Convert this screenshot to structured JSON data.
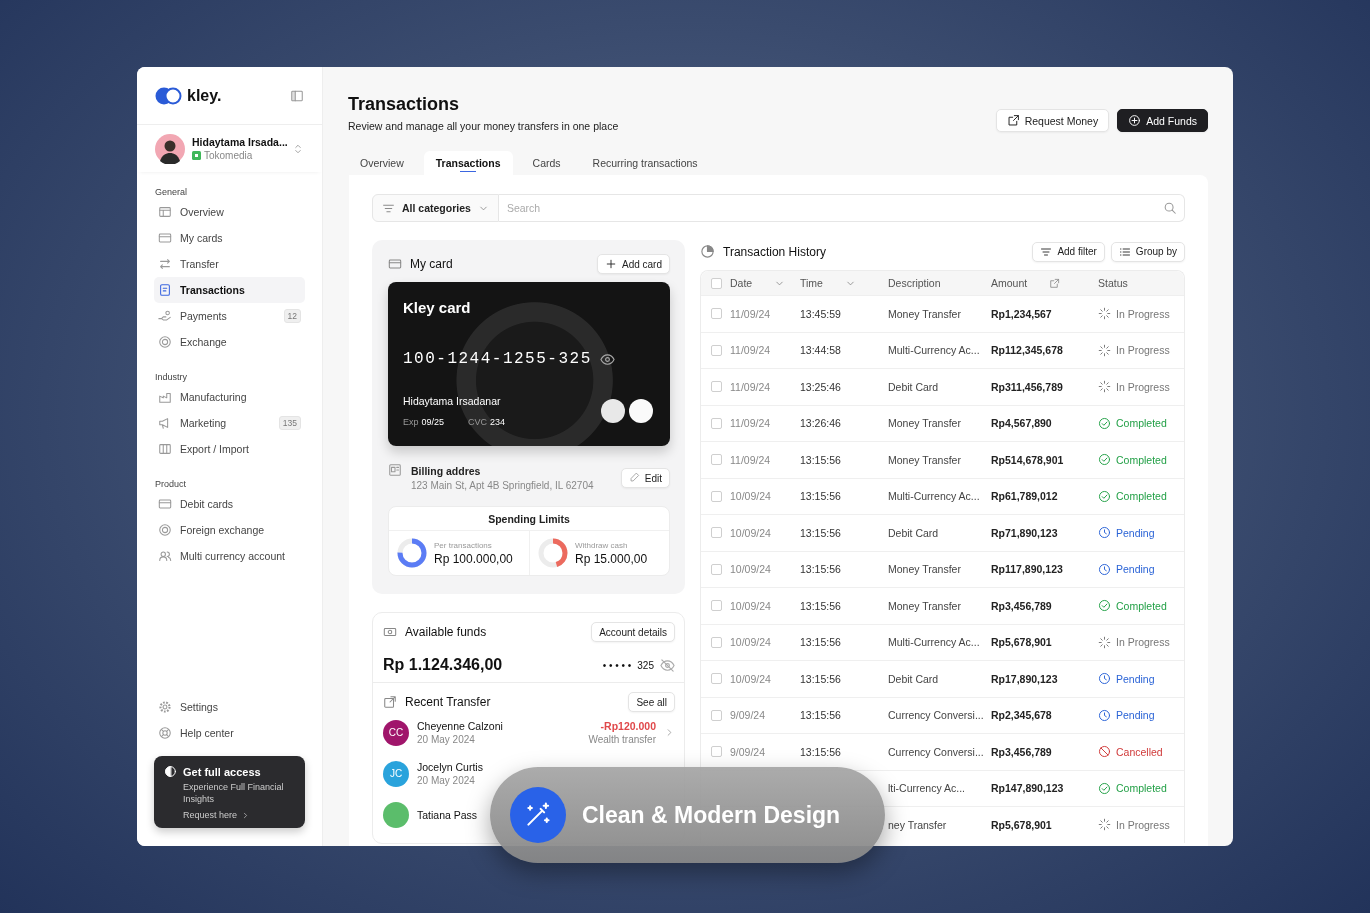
{
  "sidebar": {
    "brand": "kley.",
    "user": {
      "name": "Hidaytama Irsada...",
      "company": "Tokomedia"
    },
    "sections": [
      {
        "title": "General",
        "items": [
          {
            "label": "Overview",
            "selected": false
          },
          {
            "label": "My cards",
            "selected": false
          },
          {
            "label": "Transfer",
            "selected": false
          },
          {
            "label": "Transactions",
            "selected": true
          },
          {
            "label": "Payments",
            "selected": false,
            "badge": "12"
          },
          {
            "label": "Exchange",
            "selected": false
          }
        ]
      },
      {
        "title": "Industry",
        "items": [
          {
            "label": "Manufacturing",
            "selected": false
          },
          {
            "label": "Marketing",
            "selected": false,
            "badge": "135"
          },
          {
            "label": "Export / Import",
            "selected": false
          }
        ]
      },
      {
        "title": "Product",
        "items": [
          {
            "label": "Debit cards",
            "selected": false
          },
          {
            "label": "Foreign exchange",
            "selected": false
          },
          {
            "label": "Multi currency account",
            "selected": false
          }
        ]
      }
    ],
    "footer_items": [
      {
        "label": "Settings",
        "selected": false
      },
      {
        "label": "Help center",
        "selected": false
      }
    ],
    "promo": {
      "title": "Get full access",
      "text": "Experience Full Financial Insights",
      "link": "Request here"
    }
  },
  "header": {
    "title": "Transactions",
    "subtitle": "Review and manage all your money transfers in one place",
    "buttons": [
      {
        "label": "Request Money",
        "kind": "secondary"
      },
      {
        "label": "Add Funds",
        "kind": "primary"
      }
    ]
  },
  "tabs": [
    {
      "label": "Overview",
      "selected": false
    },
    {
      "label": "Transactions",
      "selected": true
    },
    {
      "label": "Cards",
      "selected": false
    },
    {
      "label": "Recurring transactions",
      "selected": false
    }
  ],
  "filter": {
    "category": "All categories",
    "search": {
      "placeholder": "Search"
    }
  },
  "my_card": {
    "title": "My card",
    "add_button": "Add card",
    "card": {
      "name": "Kley card",
      "number": "100-1244-1255-325",
      "holder": "Hidaytama Irsadanar",
      "exp_label": "Exp",
      "exp": "09/25",
      "cvc_label": "CVC",
      "cvc": "234"
    },
    "billing": {
      "title": "Billing addres",
      "address": "123 Main St, Apt 4B Springfield, IL 62704",
      "edit_button": "Edit"
    },
    "spending_limits": {
      "title": "Spending Limits",
      "limits": [
        {
          "label": "Per transactions",
          "value": "Rp 100.000,00",
          "level": 0.75,
          "color": "#5b7cf5"
        },
        {
          "label": "Withdraw cash",
          "value": "Rp 15.000,00",
          "level": 0.45,
          "color": "#ec6a5e"
        }
      ]
    }
  },
  "funds": {
    "title": "Available funds",
    "details_button": "Account details",
    "amount": "Rp 1.124.346,00",
    "masked_dots": "• • • • •",
    "account_end": "325"
  },
  "recent_transfer": {
    "title": "Recent Transfer",
    "see_all": "See all",
    "items": [
      {
        "initials": "CC",
        "name": "Cheyenne Calzoni",
        "date": "20 May 2024",
        "amount": "-Rp120.000",
        "note": "Wealth transfer",
        "color": "#a0156b"
      },
      {
        "initials": "JC",
        "name": "Jocelyn Curtis",
        "date": "20 May 2024",
        "color": "#2aa3dc"
      },
      {
        "name": "Tatiana Pass",
        "color": "#5bbd6b"
      }
    ]
  },
  "transaction_history": {
    "title": "Transaction History",
    "buttons": [
      "Add filter",
      "Group by"
    ],
    "select_all_checked": false,
    "columns": [
      "Date",
      "Time",
      "Description",
      "Amount",
      "Status"
    ],
    "rows": [
      {
        "checked": false,
        "date": "11/09/24",
        "time": "13:45:59",
        "description": "Money Transfer",
        "amount": "Rp1,234,567",
        "status": "In Progress",
        "kind": "in_progress"
      },
      {
        "checked": false,
        "date": "11/09/24",
        "time": "13:44:58",
        "description": "Multi-Currency Ac...",
        "amount": "Rp112,345,678",
        "status": "In Progress",
        "kind": "in_progress"
      },
      {
        "checked": false,
        "date": "11/09/24",
        "time": "13:25:46",
        "description": "Debit Card",
        "amount": "Rp311,456,789",
        "status": "In Progress",
        "kind": "in_progress"
      },
      {
        "checked": false,
        "date": "11/09/24",
        "time": "13:26:46",
        "description": "Money Transfer",
        "amount": "Rp4,567,890",
        "status": "Completed",
        "kind": "completed"
      },
      {
        "checked": false,
        "date": "11/09/24",
        "time": "13:15:56",
        "description": "Money Transfer",
        "amount": "Rp514,678,901",
        "status": "Completed",
        "kind": "completed"
      },
      {
        "checked": false,
        "date": "10/09/24",
        "time": "13:15:56",
        "description": "Multi-Currency Ac...",
        "amount": "Rp61,789,012",
        "status": "Completed",
        "kind": "completed"
      },
      {
        "checked": false,
        "date": "10/09/24",
        "time": "13:15:56",
        "description": "Debit Card",
        "amount": "Rp71,890,123",
        "status": "Pending",
        "kind": "pending"
      },
      {
        "checked": false,
        "date": "10/09/24",
        "time": "13:15:56",
        "description": "Money Transfer",
        "amount": "Rp117,890,123",
        "status": "Pending",
        "kind": "pending"
      },
      {
        "checked": false,
        "date": "10/09/24",
        "time": "13:15:56",
        "description": "Money Transfer",
        "amount": "Rp3,456,789",
        "status": "Completed",
        "kind": "completed"
      },
      {
        "checked": false,
        "date": "10/09/24",
        "time": "13:15:56",
        "description": "Multi-Currency Ac...",
        "amount": "Rp5,678,901",
        "status": "In Progress",
        "kind": "in_progress"
      },
      {
        "checked": false,
        "date": "10/09/24",
        "time": "13:15:56",
        "description": "Debit Card",
        "amount": "Rp17,890,123",
        "status": "Pending",
        "kind": "pending"
      },
      {
        "checked": false,
        "date": "9/09/24",
        "time": "13:15:56",
        "description": "Currency Conversi...",
        "amount": "Rp2,345,678",
        "status": "Pending",
        "kind": "pending"
      },
      {
        "checked": false,
        "date": "9/09/24",
        "time": "13:15:56",
        "description": "Currency Conversi...",
        "amount": "Rp3,456,789",
        "status": "Cancelled",
        "kind": "cancelled"
      },
      {
        "description": "lti-Currency Ac...",
        "amount": "Rp147,890,123",
        "status": "Completed",
        "kind": "completed"
      },
      {
        "description": "ney Transfer",
        "amount": "Rp5,678,901",
        "status": "In Progress",
        "kind": "in_progress"
      }
    ]
  },
  "overlay": {
    "text": "Clean & Modern Design"
  }
}
